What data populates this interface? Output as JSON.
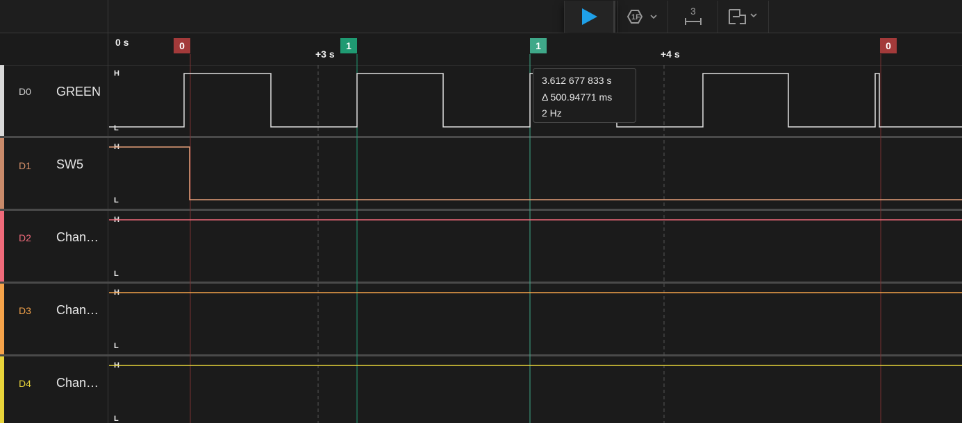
{
  "toolbar": {
    "play_icon": "play-icon",
    "trigger_icon": "trigger-icon",
    "measure_icon": "measure-icon",
    "measure_count": "3",
    "layout_icon": "layout-icon"
  },
  "ruler": {
    "origin_label": "0 s",
    "tick_labels": [
      "+3 s",
      "+4 s"
    ],
    "markers": [
      {
        "label": "0",
        "color": "#a33a3a"
      },
      {
        "label": "1",
        "color": "#1f9a72"
      },
      {
        "label": "1",
        "color": "#3fa889"
      },
      {
        "label": "0",
        "color": "#a33a3a"
      }
    ]
  },
  "channels": [
    {
      "id": "D0",
      "name": "GREEN",
      "color": "#d9d9d9",
      "high": "H",
      "low": "L"
    },
    {
      "id": "D1",
      "name": "SW5",
      "color": "#e6a07a",
      "high": "H",
      "low": "L"
    },
    {
      "id": "D2",
      "name": "Chan…",
      "color": "#f06a7a",
      "high": "H",
      "low": "L"
    },
    {
      "id": "D3",
      "name": "Chan…",
      "color": "#f5a34a",
      "high": "H",
      "low": "L"
    },
    {
      "id": "D4",
      "name": "Chan…",
      "color": "#e8d43a",
      "high": "H",
      "low": "L"
    }
  ],
  "tooltip": {
    "time": "3.612 677 833 s",
    "delta": "Δ 500.94771 ms",
    "frequency": "2 Hz"
  }
}
